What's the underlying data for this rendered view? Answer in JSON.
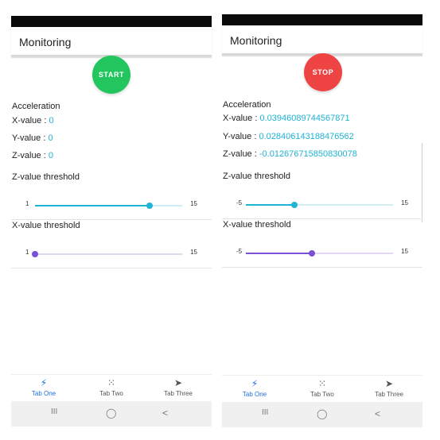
{
  "screens": [
    {
      "title": "Monitoring",
      "fab": {
        "label": "START",
        "color": "#22c55e"
      },
      "acceleration_label": "Acceleration",
      "x_label": "X-value : ",
      "x_value": "0",
      "y_label": "Y-value : ",
      "y_value": "0",
      "z_label": "Z-value : ",
      "z_value": "0",
      "z_threshold": {
        "label": "Z-value threshold",
        "min": "1",
        "max": "15",
        "position": 0.78,
        "color": "#1fb3d6"
      },
      "x_threshold": {
        "label": "X-value threshold",
        "min": "1",
        "max": "15",
        "position": 0.0,
        "color": "#7b4fd6"
      }
    },
    {
      "title": "Monitoring",
      "fab": {
        "label": "STOP",
        "color": "#ef4444"
      },
      "acceleration_label": "Acceleration",
      "x_label": "X-value : ",
      "x_value": "0.03946089744567871",
      "y_label": "Y-value : ",
      "y_value": "0.028406143188476562",
      "z_label": "Z-value : ",
      "z_value": "-0.012676715850830078",
      "z_threshold": {
        "label": "Z-value threshold",
        "min": "-5",
        "max": "15",
        "position": 0.33,
        "color": "#1fb3d6"
      },
      "x_threshold": {
        "label": "X-value threshold",
        "min": "-5",
        "max": "15",
        "position": 0.45,
        "color": "#7b4fd6"
      }
    }
  ],
  "tabs": [
    {
      "label": "Tab One",
      "icon": "bolt-icon",
      "glyph": "⚡",
      "active": true
    },
    {
      "label": "Tab Two",
      "icon": "grid-icon",
      "glyph": "⁙",
      "active": false
    },
    {
      "label": "Tab Three",
      "icon": "send-icon",
      "glyph": "➤",
      "active": false
    }
  ],
  "navbar": {
    "recents": "III",
    "home": "◯",
    "back": "<"
  },
  "colors": {
    "accent": "#1fb3d6",
    "purple": "#7b4fd6",
    "active_tab": "#1e6fe0"
  }
}
